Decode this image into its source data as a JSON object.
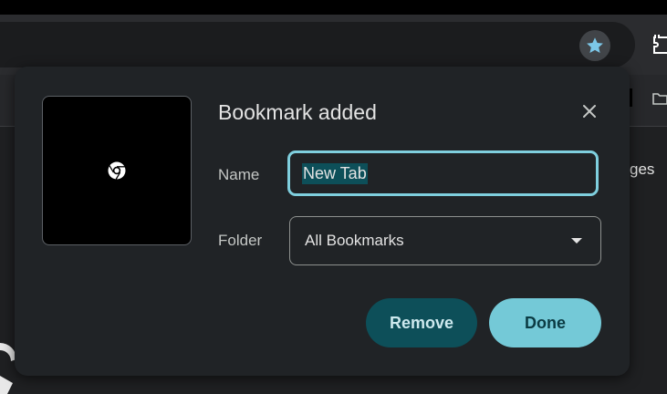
{
  "browser": {
    "toolbar": {
      "bookmark_star_icon": "star-icon",
      "extensions_icon": "puzzle-icon"
    },
    "bookmarks_bar": {
      "folder_icon": "folder-icon"
    },
    "page_text_fragment": "ges"
  },
  "dialog": {
    "title": "Bookmark added",
    "close_icon": "close-icon",
    "thumbnail_icon": "chrome-icon",
    "name_label": "Name",
    "name_value": "New Tab",
    "folder_label": "Folder",
    "folder_value": "All Bookmarks",
    "remove_label": "Remove",
    "done_label": "Done"
  },
  "colors": {
    "accent": "#74c9d7",
    "accent_dark": "#0d4f59",
    "dialog_bg": "#202326",
    "star": "#7cc7e8"
  }
}
